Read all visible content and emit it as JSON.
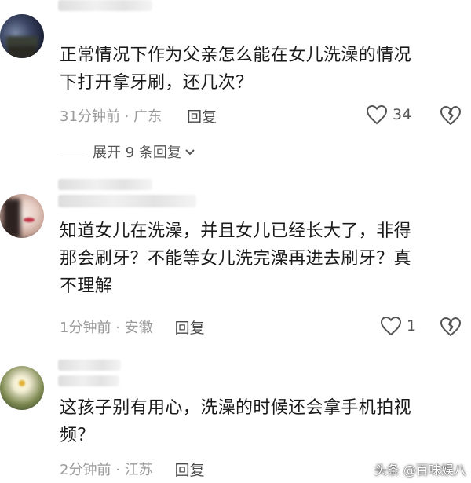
{
  "comments": [
    {
      "text_line1": "正常情况下作为父亲怎么能在女儿洗澡的情况",
      "text_line2": "下打开拿牙刷，还几次？",
      "time_location": "31分钟前 · 广东",
      "reply_label": "回复",
      "like_count": "34",
      "expand_label": "展开 9 条回复",
      "expand_icon": "chevron-down-icon"
    },
    {
      "text_line1": "知道女儿在洗澡，并且女儿已经长大了，非得",
      "text_line2": "那会刷牙？不能等女儿洗完澡再进去刷牙？真",
      "text_line3": "不理解",
      "time_location": "1分钟前 · 安徽",
      "reply_label": "回复",
      "like_count": "1"
    },
    {
      "text_line1": "这孩子别有用心，洗澡的时候还会拿手机拍视",
      "text_line2": "频？",
      "time_location": "2分钟前 · 江苏",
      "reply_label": "回复"
    }
  ],
  "icons": {
    "like": "heart-outline-icon",
    "dislike": "broken-heart-icon"
  },
  "watermark": "头条 @百味娱八",
  "colors": {
    "text": "#1a1a1a",
    "meta": "#9a9a9a",
    "reply": "#4a4a4a",
    "icon": "#555555"
  }
}
